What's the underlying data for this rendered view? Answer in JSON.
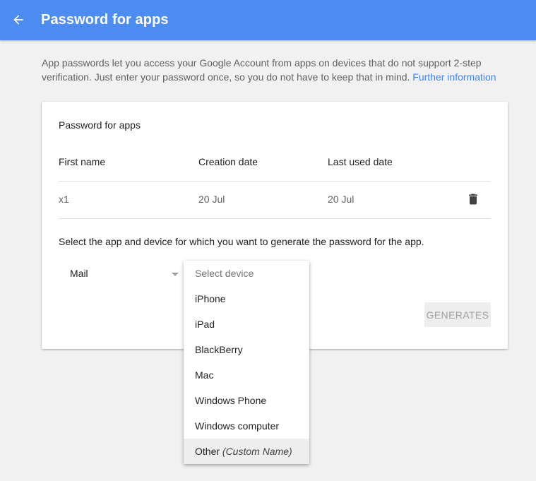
{
  "header": {
    "title": "Password for apps",
    "background_color": "#4d8cf1",
    "back_icon": "arrow-left-icon"
  },
  "intro": {
    "text": "App passwords let you access your Google Account from apps on devices that do not support 2-step verification. Just enter your password once, so you do not have to keep that in mind. ",
    "link_label": "Further information",
    "link_color": "#4285f4"
  },
  "card": {
    "title": "Password for apps",
    "columns": [
      "First name",
      "Creation date",
      "Last used date"
    ],
    "rows": [
      {
        "name": "x1",
        "created": "20 Jul",
        "last_used": "20 Jul",
        "action_icon": "trash-icon"
      }
    ],
    "instruction": "Select the app and device for which you want to generate the password for the app.",
    "app_select": {
      "value": "Mail"
    },
    "generate_button": {
      "label": "GENERATES",
      "enabled": false
    }
  },
  "device_dropdown": {
    "placeholder": "Select device",
    "options": [
      "iPhone",
      "iPad",
      "BlackBerry",
      "Mac",
      "Windows Phone",
      "Windows computer"
    ],
    "other": {
      "label": "Other",
      "hint": "(Custom Name)"
    },
    "highlighted": "Other"
  }
}
